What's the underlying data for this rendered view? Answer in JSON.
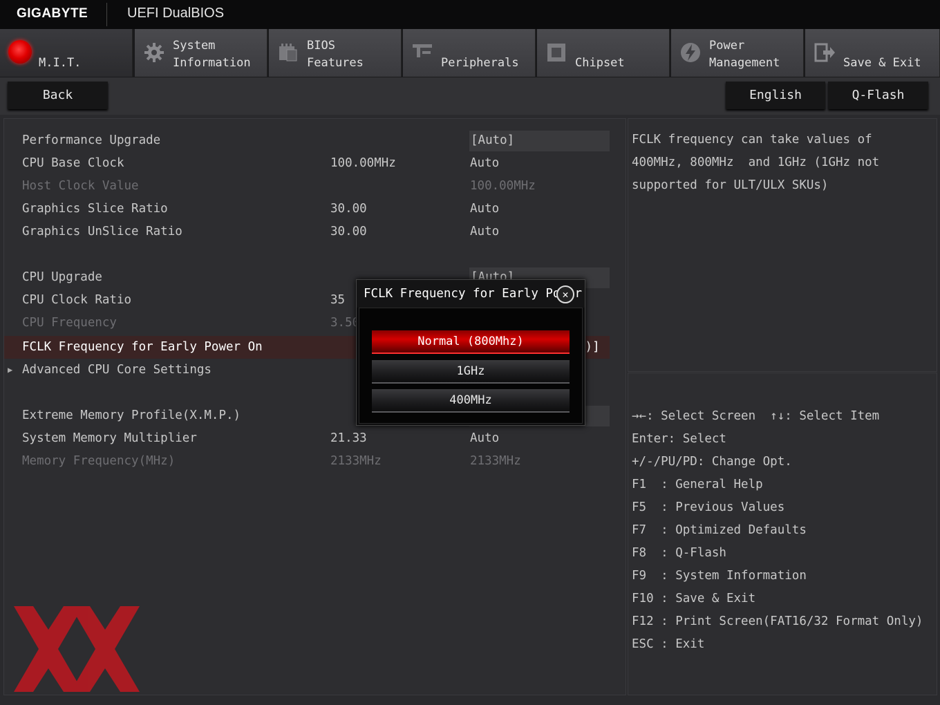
{
  "header": {
    "brand": "GIGABYTE",
    "product": "UEFI DualBIOS"
  },
  "tabs": [
    {
      "line1": "",
      "line2": "M.I.T.",
      "icon": "mit-red-dot-icon"
    },
    {
      "line1": "System",
      "line2": "Information",
      "icon": "gear-icon"
    },
    {
      "line1": "BIOS",
      "line2": "Features",
      "icon": "bios-chip-icon"
    },
    {
      "line1": "",
      "line2": "Peripherals",
      "icon": "peripherals-icon"
    },
    {
      "line1": "",
      "line2": "Chipset",
      "icon": "chipset-icon"
    },
    {
      "line1": "Power",
      "line2": "Management",
      "icon": "power-icon"
    },
    {
      "line1": "",
      "line2": "Save & Exit",
      "icon": "save-exit-icon"
    }
  ],
  "subbar": {
    "back": "Back",
    "language": "English",
    "qflash": "Q-Flash"
  },
  "settings": [
    {
      "label": "Performance Upgrade",
      "current": "",
      "value": "[Auto]",
      "boxed": true
    },
    {
      "label": "CPU Base Clock",
      "current": "100.00MHz",
      "value": "Auto"
    },
    {
      "label": "Host Clock Value",
      "current": "",
      "value": "100.00MHz",
      "dim": true
    },
    {
      "label": "Graphics Slice Ratio",
      "current": "30.00",
      "value": "Auto"
    },
    {
      "label": "Graphics UnSlice Ratio",
      "current": "30.00",
      "value": "Auto"
    },
    {
      "label": "CPU Upgrade",
      "current": "",
      "value": "[Auto]",
      "boxed": true
    },
    {
      "label": "CPU Clock Ratio",
      "current": "35",
      "value": ""
    },
    {
      "label": "CPU Frequency",
      "current": "3.50",
      "value": "",
      "dim": true
    },
    {
      "label": "FCLK Frequency for Early Power On",
      "current": "",
      "value": "0)]",
      "selected": true
    },
    {
      "label": "Advanced CPU Core Settings",
      "current": "",
      "value": "",
      "submenu": true
    },
    {
      "label": "Extreme Memory Profile(X.M.P.)",
      "current": "",
      "value": "",
      "boxed": true
    },
    {
      "label": "System Memory Multiplier",
      "current": "21.33",
      "value": "Auto"
    },
    {
      "label": "Memory Frequency(MHz)",
      "current": "2133MHz",
      "value": "2133MHz",
      "dim": true
    }
  ],
  "help": {
    "text": "FCLK frequency can take values of\n400MHz, 800MHz  and 1GHz (1GHz not\nsupported for ULT/ULX SKUs)"
  },
  "keys": [
    "→←: Select Screen  ↑↓: Select Item",
    "Enter: Select",
    "+/-/PU/PD: Change Opt.",
    "F1  : General Help",
    "F5  : Previous Values",
    "F7  : Optimized Defaults",
    "F8  : Q-Flash",
    "F9  : System Information",
    "F10 : Save & Exit",
    "F12 : Print Screen(FAT16/32 Format Only)",
    "ESC : Exit"
  ],
  "popup": {
    "title": "FCLK Frequency for Early Power",
    "options": [
      "Normal (800Mhz)",
      "1GHz",
      "400MHz"
    ],
    "selected_index": 0
  },
  "colors": {
    "accent": "#d40000",
    "selected_row": "#3b2424",
    "panel": "#2d2d30"
  }
}
